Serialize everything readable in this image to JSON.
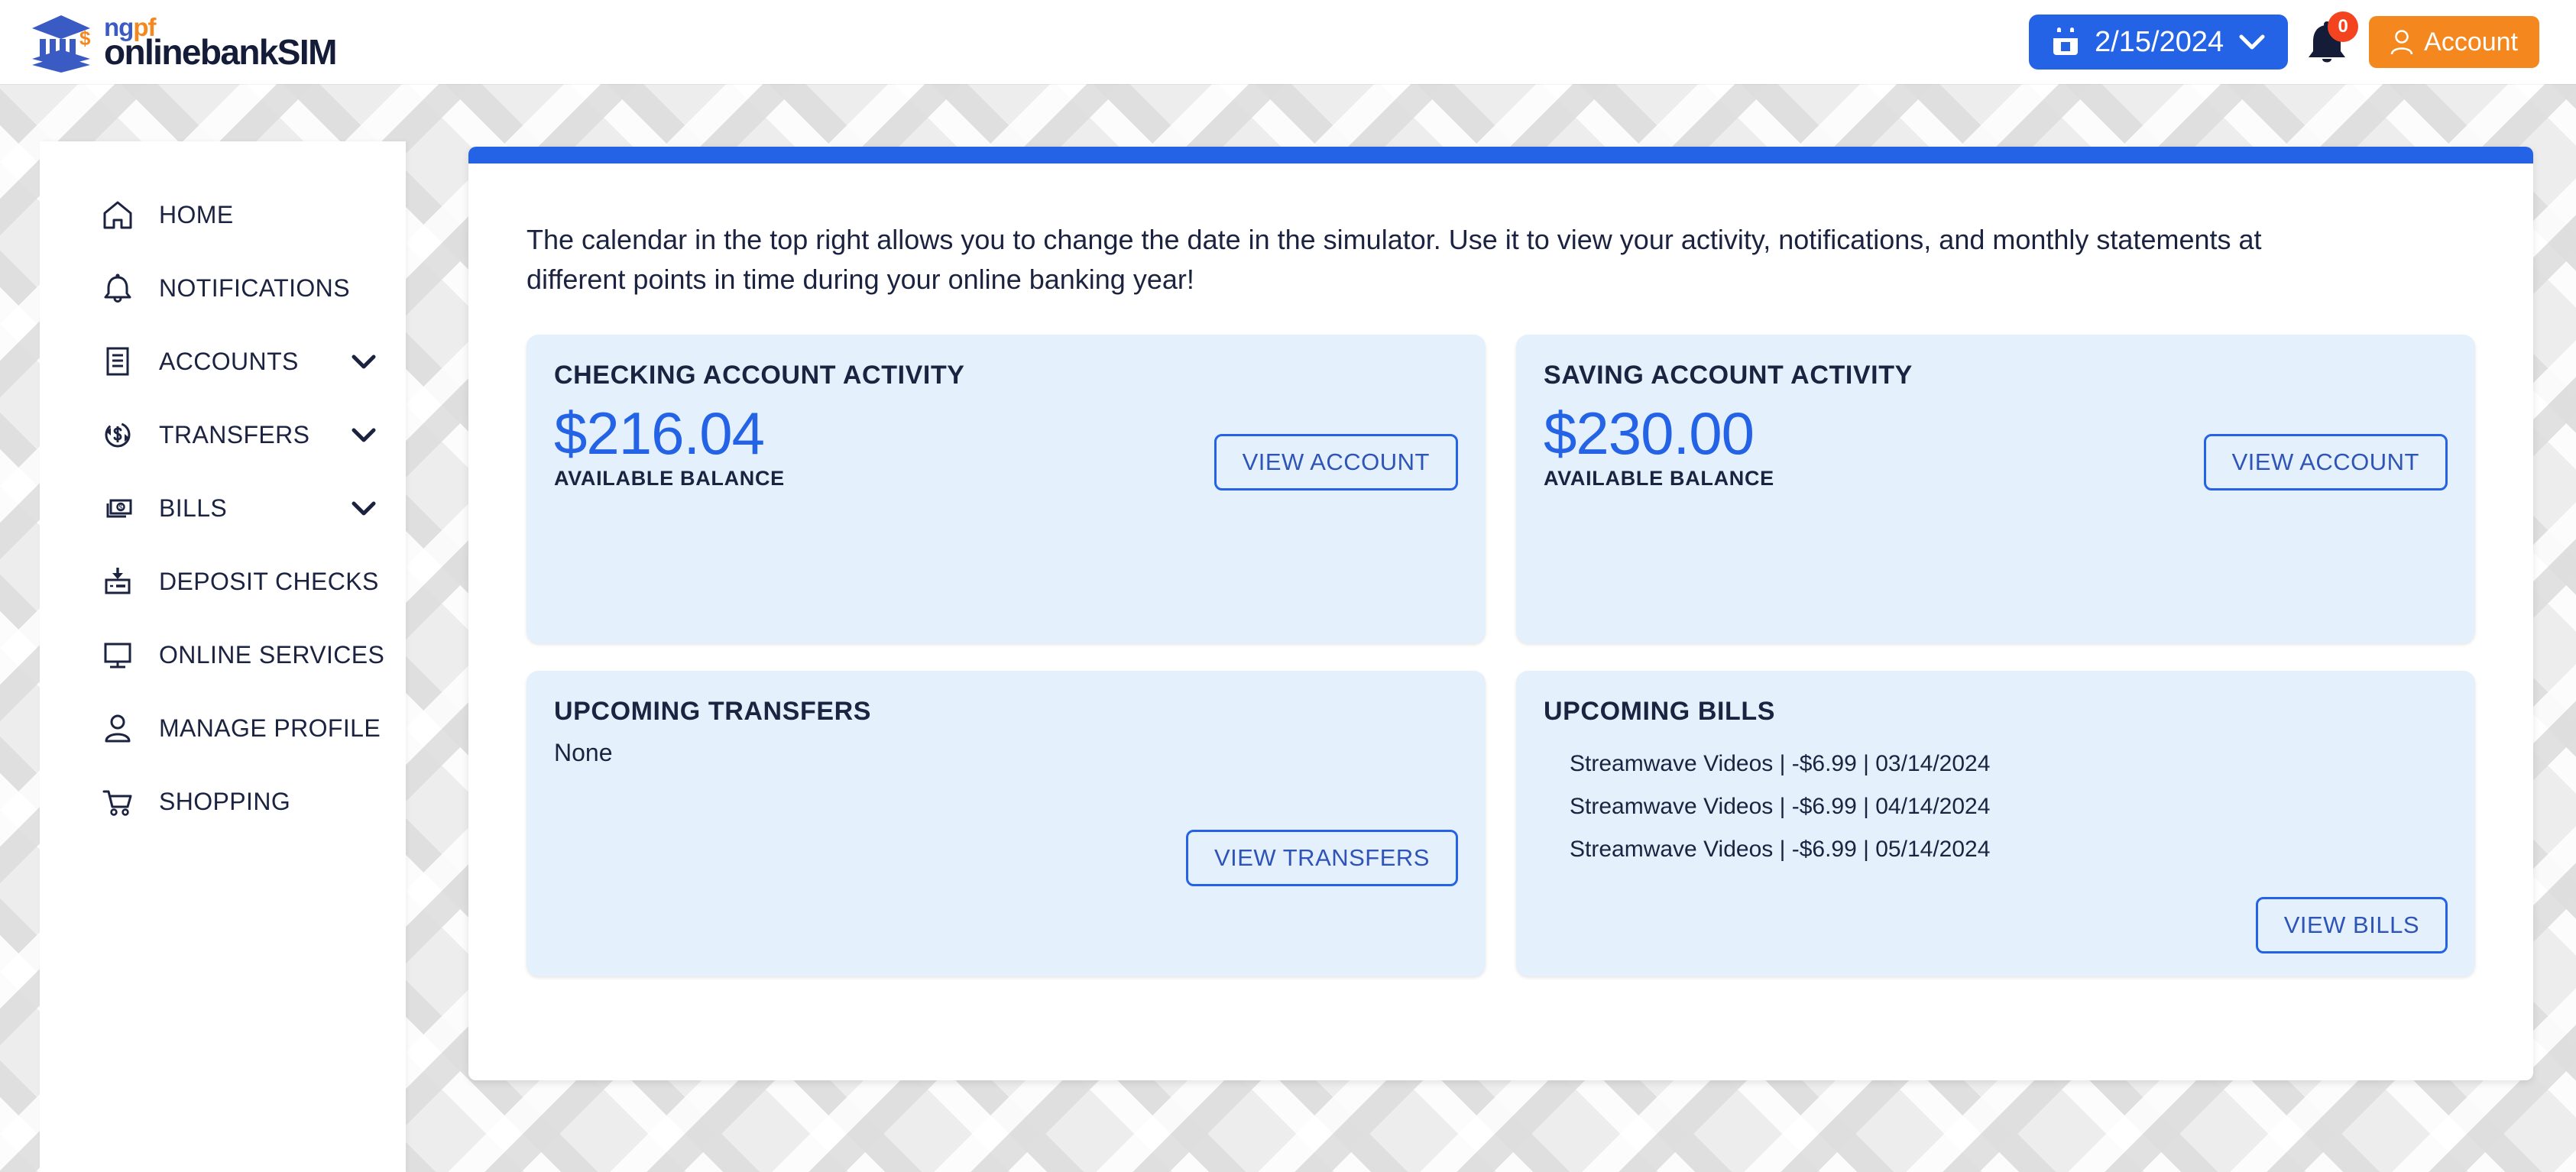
{
  "brand": {
    "name_top": "ngpf",
    "name_top_ng": "ng",
    "name_top_pf": "pf",
    "name_bottom": "onlinebankSIM",
    "logo_icon": "bank-building-icon"
  },
  "header": {
    "date_value": "2/15/2024",
    "date_icon": "calendar-icon",
    "date_chevron_icon": "chevron-down-icon",
    "bell_icon": "notification-bell-icon",
    "bell_badge_count": "0",
    "account_label": "Account",
    "account_icon": "user-icon",
    "accent_blue": "#2563E6",
    "accent_orange": "#F5871F",
    "badge_red": "#F4441F"
  },
  "sidebar": {
    "items": [
      {
        "label": "HOME",
        "icon": "home-icon",
        "expandable": false
      },
      {
        "label": "NOTIFICATIONS",
        "icon": "bell-icon",
        "expandable": false
      },
      {
        "label": "ACCOUNTS",
        "icon": "document-lines-icon",
        "expandable": true
      },
      {
        "label": "TRANSFERS",
        "icon": "dollar-refresh-icon",
        "expandable": true
      },
      {
        "label": "BILLS",
        "icon": "money-bills-icon",
        "expandable": true
      },
      {
        "label": "DEPOSIT CHECKS",
        "icon": "check-deposit-icon",
        "expandable": false
      },
      {
        "label": "ONLINE SERVICES",
        "icon": "monitor-icon",
        "expandable": false
      },
      {
        "label": "MANAGE PROFILE",
        "icon": "person-icon",
        "expandable": false
      },
      {
        "label": "SHOPPING",
        "icon": "shopping-cart-icon",
        "expandable": false
      }
    ]
  },
  "main": {
    "intro_text": "The calendar in the top right allows you to change the date in the simulator. Use it to view your activity, notifications, and monthly statements at different points in time during your online banking year!",
    "checking": {
      "title": "CHECKING ACCOUNT ACTIVITY",
      "amount": "$216.04",
      "caption": "AVAILABLE BALANCE",
      "button_label": "VIEW ACCOUNT"
    },
    "saving": {
      "title": "SAVING ACCOUNT ACTIVITY",
      "amount": "$230.00",
      "caption": "AVAILABLE BALANCE",
      "button_label": "VIEW ACCOUNT"
    },
    "transfers": {
      "title": "UPCOMING TRANSFERS",
      "empty_text": "None",
      "button_label": "VIEW TRANSFERS"
    },
    "bills": {
      "title": "UPCOMING BILLS",
      "items": [
        "Streamwave Videos | -$6.99 | 03/14/2024",
        "Streamwave Videos | -$6.99 | 04/14/2024",
        "Streamwave Videos | -$6.99 | 05/14/2024"
      ],
      "button_label": "VIEW BILLS"
    }
  }
}
